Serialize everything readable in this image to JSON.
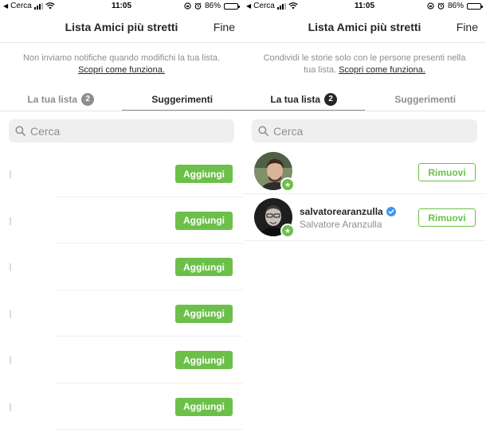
{
  "statusbar": {
    "carrier": "Cerca",
    "time": "11:05",
    "battery": "86%",
    "battery_level": 0.86
  },
  "left_screen": {
    "title": "Lista Amici più stretti",
    "done": "Fine",
    "info_text": "Non inviamo notifiche quando modifichi la tua lista. ",
    "info_link": "Scopri come funziona.",
    "tabs": [
      {
        "label": "La tua lista",
        "badge": "2",
        "active": false
      },
      {
        "label": "Suggerimenti",
        "active": true
      }
    ],
    "search_placeholder": "Cerca",
    "suggestions": [
      {
        "button": "Aggiungi"
      },
      {
        "button": "Aggiungi"
      },
      {
        "button": "Aggiungi"
      },
      {
        "button": "Aggiungi"
      },
      {
        "button": "Aggiungi"
      },
      {
        "button": "Aggiungi"
      }
    ]
  },
  "right_screen": {
    "title": "Lista Amici più stretti",
    "done": "Fine",
    "info_text": "Condividi le storie solo con le persone presenti nella tua lista. ",
    "info_link": "Scopri come funziona.",
    "tabs": [
      {
        "label": "La tua lista",
        "badge": "2",
        "active": true
      },
      {
        "label": "Suggerimenti",
        "active": false
      }
    ],
    "search_placeholder": "Cerca",
    "friends": [
      {
        "username": "",
        "fullname": "",
        "verified": false,
        "button": "Rimuovi"
      },
      {
        "username": "salvatorearanzulla",
        "fullname": "Salvatore Aranzulla",
        "verified": true,
        "button": "Rimuovi"
      }
    ]
  },
  "colors": {
    "accent_green": "#6cc04a",
    "text_dark": "#262626",
    "text_gray": "#8e8e8e",
    "verified_blue": "#3897f0"
  }
}
